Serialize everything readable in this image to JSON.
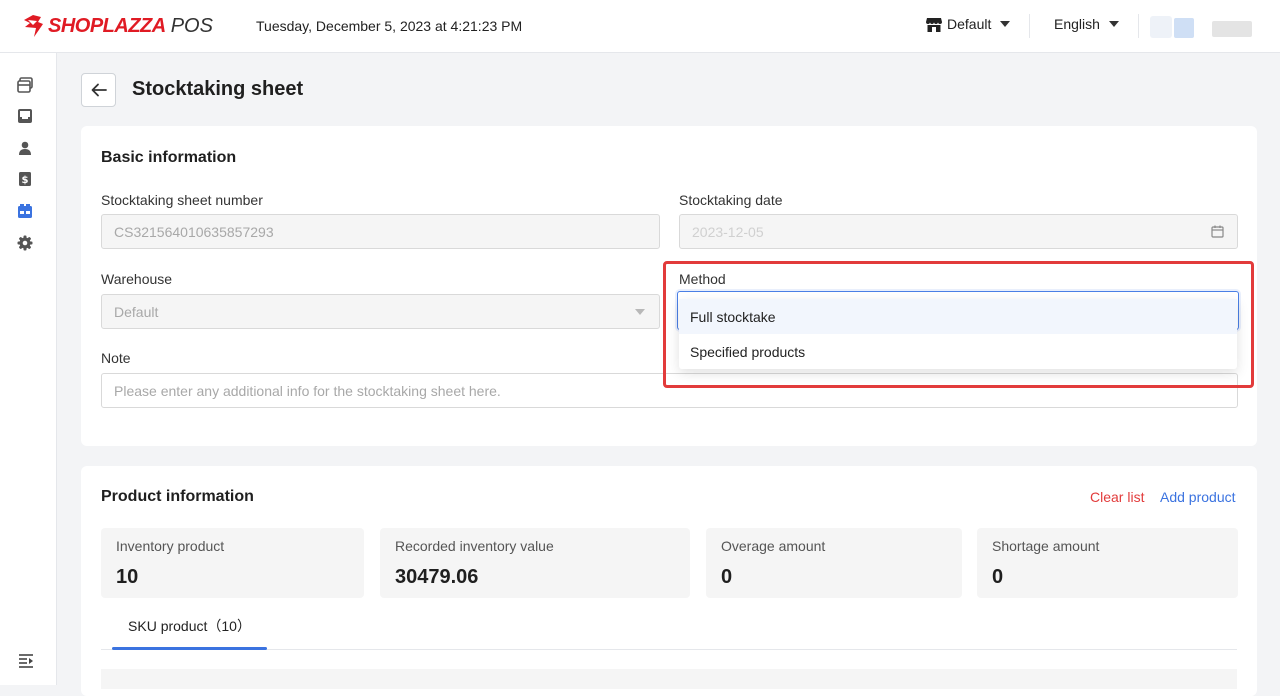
{
  "header": {
    "logo_text": "SHOPLAZZA",
    "logo_suffix": "POS",
    "datetime": "Tuesday, December 5, 2023 at 4:21:23 PM",
    "store": "Default",
    "language": "English"
  },
  "sidebar": {
    "items": [
      {
        "icon": "orders-icon"
      },
      {
        "icon": "inbox-icon"
      },
      {
        "icon": "customer-icon"
      },
      {
        "icon": "finance-icon"
      },
      {
        "icon": "inventory-icon",
        "active": true
      },
      {
        "icon": "settings-icon"
      }
    ],
    "collapse_icon": "collapse-menu-icon"
  },
  "page": {
    "title": "Stocktaking sheet"
  },
  "basic": {
    "title": "Basic information",
    "sheet_number_label": "Stocktaking sheet number",
    "sheet_number_value": "CS321564010635857293",
    "date_label": "Stocktaking date",
    "date_value": "2023-12-05",
    "warehouse_label": "Warehouse",
    "warehouse_value": "Default",
    "method_label": "Method",
    "method_options": [
      "Full stocktake",
      "Specified products"
    ],
    "note_label": "Note",
    "note_placeholder": "Please enter any additional info for the stocktaking sheet here."
  },
  "product": {
    "title": "Product information",
    "clear_list": "Clear list",
    "add_product": "Add product",
    "stats": [
      {
        "label": "Inventory product",
        "value": "10"
      },
      {
        "label": "Recorded inventory value",
        "value": "30479.06"
      },
      {
        "label": "Overage amount",
        "value": "0"
      },
      {
        "label": "Shortage amount",
        "value": "0"
      }
    ],
    "tab_label": "SKU product（10）"
  },
  "colors": {
    "brand_red": "#e01b24",
    "accent_blue": "#3b73e0",
    "highlight_red": "#e23b3b"
  }
}
